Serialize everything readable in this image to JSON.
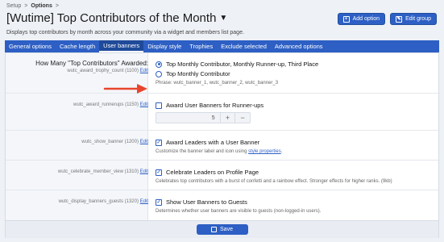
{
  "breadcrumb": [
    "Setup",
    ">",
    "Options",
    ">"
  ],
  "page": {
    "title": "[Wutime] Top Contributors of the Month",
    "description": "Displays top contributors by month across your community via a widget and members list page."
  },
  "header_buttons": {
    "add_option": "Add option",
    "edit_group": "Edit group"
  },
  "tabs": [
    "General options",
    "Cache length",
    "User banners",
    "Display style",
    "Trophies",
    "Exclude selected",
    "Advanced options"
  ],
  "active_tab": "User banners",
  "rows": {
    "awarded": {
      "title": "How Many \"Top Contributors\" Awarded:",
      "key": "wutc_award_trophy_count (1100)",
      "edit": "Edit",
      "options": [
        "Top Monthly Contributor, Monthly Runner-up, Third Place",
        "Top Monthly Contributor"
      ],
      "phrase": "Phrase: wutc_banner_1, wutc_banner_2, wutc_banner_3"
    },
    "runnerups": {
      "key": "wutc_award_runnerups (1150)",
      "edit": "Edit",
      "label": "Award User Banners for Runner-ups",
      "stepper_value": "5",
      "plus": "+",
      "minus": "−"
    },
    "show_banner": {
      "key": "wutc_show_banner (1200)",
      "edit": "Edit",
      "label": "Award Leaders with a User Banner",
      "hint_prefix": "Customize the banner label and icon using",
      "hint_link": "style properties",
      "hint_suffix": "."
    },
    "celebrate": {
      "key": "wutc_celebrate_member_view (1310)",
      "edit": "Edit",
      "label": "Celebrate Leaders on Profile Page",
      "hint": "Celebrates top contributors with a burst of confetti and a rainbow effect. Stronger effects for higher ranks. (9kb)"
    },
    "guests": {
      "key": "wutc_display_banners_guests (1320)",
      "edit": "Edit",
      "label": "Show User Banners to Guests",
      "hint": "Determines whether user banners are visible to guests (non-logged-in users)."
    }
  },
  "save_label": "Save",
  "colors": {
    "accent": "#2d5fc4",
    "arrow": "#e8452c"
  }
}
